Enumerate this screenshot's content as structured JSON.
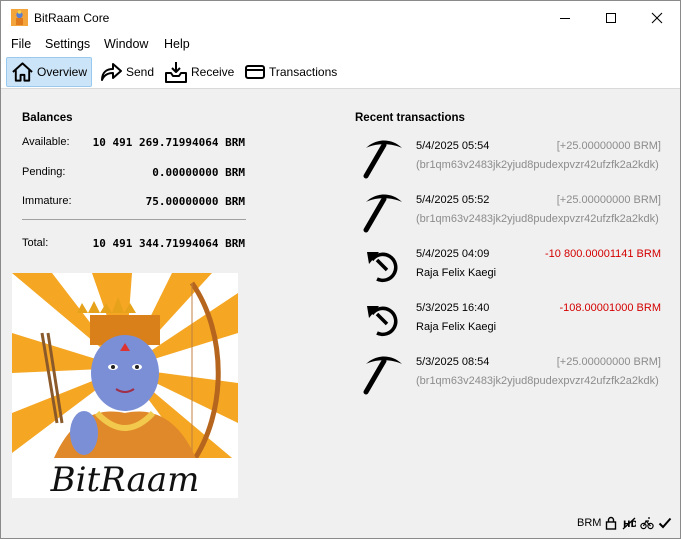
{
  "window": {
    "title": "BitRaam Core"
  },
  "menu": {
    "file": "File",
    "settings": "Settings",
    "window": "Window",
    "help": "Help"
  },
  "toolbar": {
    "overview": "Overview",
    "send": "Send",
    "receive": "Receive",
    "transactions": "Transactions"
  },
  "balances": {
    "heading": "Balances",
    "available_label": "Available:",
    "available_value": "10 491 269.71994064 BRM",
    "pending_label": "Pending:",
    "pending_value": "0.00000000 BRM",
    "immature_label": "Immature:",
    "immature_value": "75.00000000 BRM",
    "total_label": "Total:",
    "total_value": "10 491 344.71994064 BRM"
  },
  "recent": {
    "heading": "Recent transactions",
    "items": [
      {
        "date": "5/4/2025 05:54",
        "amount": "[+25.00000000 BRM]",
        "address": "(br1qm63v2483jk2yjud8pudexpvzr42ufzfk2a2kdk)",
        "icon": "pickaxe-icon",
        "kind": "pos"
      },
      {
        "date": "5/4/2025 05:52",
        "amount": "[+25.00000000 BRM]",
        "address": "(br1qm63v2483jk2yjud8pudexpvzr42ufzfk2a2kdk)",
        "icon": "pickaxe-icon",
        "kind": "pos"
      },
      {
        "date": "5/4/2025 04:09",
        "amount": "-10 800.00001141 BRM",
        "address": "Raja Felix Kaegi",
        "icon": "send-arrow-icon",
        "kind": "neg"
      },
      {
        "date": "5/3/2025 16:40",
        "amount": "-108.00001000 BRM",
        "address": "Raja Felix Kaegi",
        "icon": "send-arrow-icon",
        "kind": "neg"
      },
      {
        "date": "5/3/2025 08:54",
        "amount": "[+25.00000000 BRM]",
        "address": "(br1qm63v2483jk2yjud8pudexpvzr42ufzfk2a2kdk)",
        "icon": "pickaxe-icon",
        "kind": "pos"
      }
    ]
  },
  "logo": {
    "text": "BitRaam"
  },
  "status": {
    "unit": "BRM"
  },
  "colors": {
    "accent": "#cce4f7",
    "negative": "#d40000",
    "muted": "#8c8c8c"
  }
}
